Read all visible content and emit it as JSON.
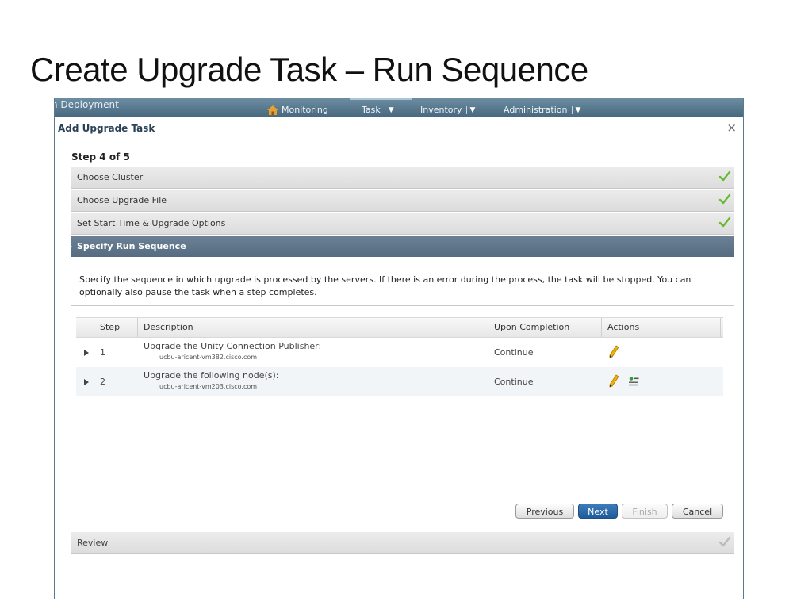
{
  "slide": {
    "title": "Create Upgrade Task – Run Sequence"
  },
  "appbar": {
    "app_name": "n Deployment",
    "nav": [
      {
        "label": "Monitoring",
        "icon": "home-icon"
      },
      {
        "label": "Task"
      },
      {
        "label": "Inventory"
      },
      {
        "label": "Administration"
      }
    ],
    "caret": "▼"
  },
  "dialog": {
    "title": "Add Upgrade Task",
    "close": "×",
    "step_indicator": "Step 4 of 5",
    "steps": [
      {
        "label": "Choose Cluster",
        "status": "complete"
      },
      {
        "label": "Choose Upgrade File",
        "status": "complete"
      },
      {
        "label": "Set Start Time & Upgrade Options",
        "status": "complete"
      },
      {
        "label": "Specify Run Sequence",
        "status": "active"
      },
      {
        "label": "Review",
        "status": "pending"
      }
    ],
    "instructions": "Specify the sequence in which upgrade is processed by the servers. If there is an error during the process, the task will be stopped. You can optionally also pause the task when a step completes.",
    "table": {
      "headers": [
        "Step",
        "Description",
        "Upon Completion",
        "Actions"
      ],
      "rows": [
        {
          "step": "1",
          "description": "Upgrade the Unity Connection Publisher:",
          "host": "ucbu-aricent-vm382.cisco.com",
          "completion": "Continue",
          "actions": [
            "pencil-icon"
          ]
        },
        {
          "step": "2",
          "description": "Upgrade the following node(s):",
          "host": "ucbu-aricent-vm203.cisco.com",
          "completion": "Continue",
          "actions": [
            "pencil-icon",
            "properties-icon"
          ]
        }
      ]
    },
    "buttons": {
      "previous": "Previous",
      "next": "Next",
      "finish": "Finish",
      "cancel": "Cancel"
    }
  },
  "colors": {
    "check": "#66bb33",
    "check_pending": "#bbbbbb",
    "active_step": "#5f7589",
    "next_button": "#2a6aa8"
  }
}
